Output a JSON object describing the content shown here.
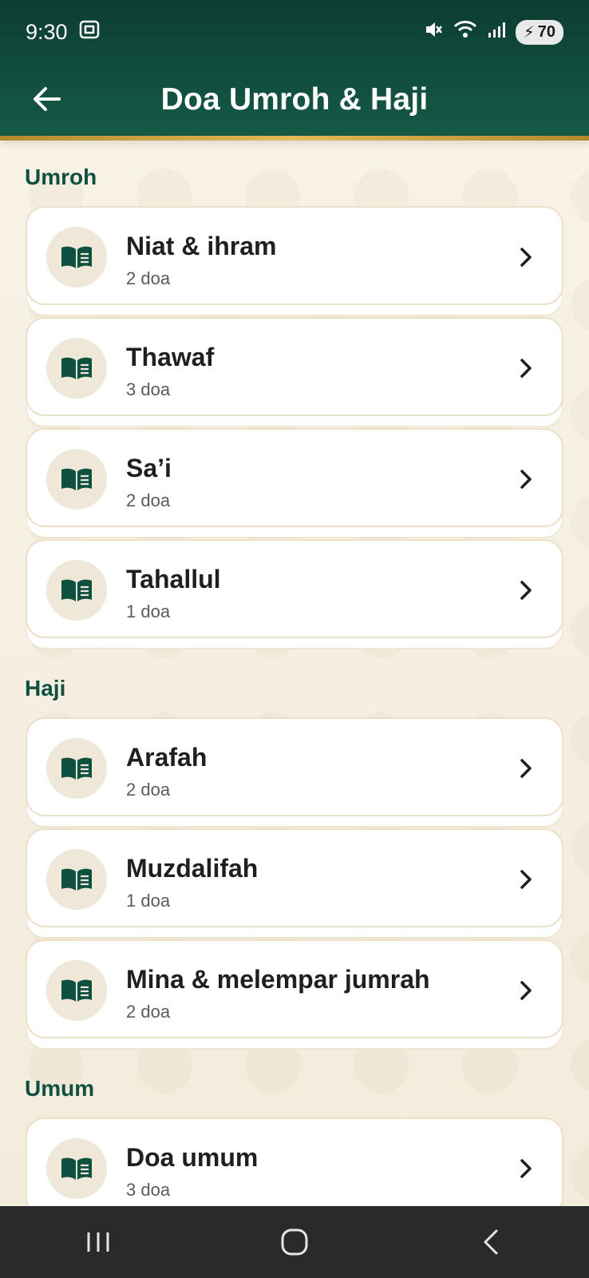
{
  "status_bar": {
    "time": "9:30",
    "battery": "70"
  },
  "toolbar": {
    "title": "Doa Umroh & Haji"
  },
  "sections": [
    {
      "title": "Umroh",
      "items": [
        {
          "title": "Niat & ihram",
          "count": "2 doa"
        },
        {
          "title": "Thawaf",
          "count": "3 doa"
        },
        {
          "title": "Sa’i",
          "count": "2 doa"
        },
        {
          "title": "Tahallul",
          "count": "1 doa"
        }
      ]
    },
    {
      "title": "Haji",
      "items": [
        {
          "title": "Arafah",
          "count": "2 doa"
        },
        {
          "title": "Muzdalifah",
          "count": "1 doa"
        },
        {
          "title": "Mina & melempar jumrah",
          "count": "2 doa"
        }
      ]
    },
    {
      "title": "Umum",
      "items": [
        {
          "title": "Doa umum",
          "count": "3 doa"
        }
      ]
    }
  ],
  "icons": {
    "card": "open-book-icon",
    "chevron": "chevron-right-icon",
    "back": "arrow-left-icon"
  },
  "colors": {
    "appbar": "#145a46",
    "accent_gold": "#d4ad4a",
    "section_title": "#0f5140",
    "background": "#f6efe2"
  }
}
